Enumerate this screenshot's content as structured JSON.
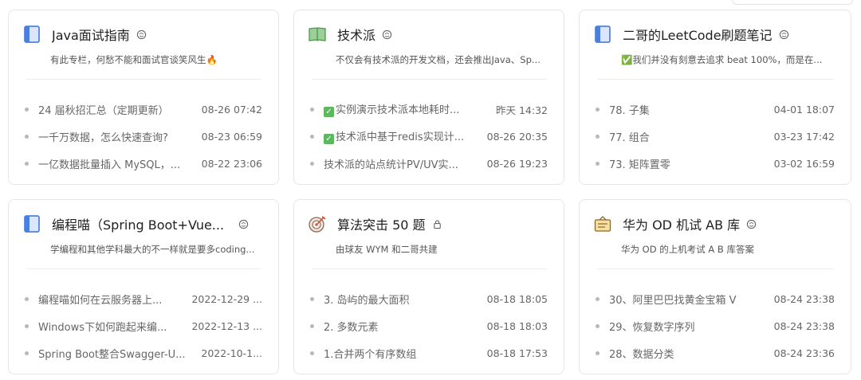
{
  "columns": [
    {
      "title": "Java面试指南",
      "icon": "blue-book-icon",
      "description": "有此专栏，何愁不能和面试官谈笑风生🔥",
      "articles": [
        {
          "title": "24 届秋招汇总（定期更新）",
          "time": "08-26 07:42"
        },
        {
          "title": "一千万数据，怎么快速查询?",
          "time": "08-23 06:59"
        },
        {
          "title": "一亿数据批量插入 MySQL，...",
          "time": "08-22 23:06"
        }
      ]
    },
    {
      "title": "技术派",
      "icon": "green-open-book-icon",
      "description": "不仅会有技术派的开发文档，还会推出Java、Sp...",
      "articles": [
        {
          "title": "实例演示技术派本地耗时...",
          "time": "昨天 14:32",
          "check": true
        },
        {
          "title": "技术派中基于redis实现计...",
          "time": "08-26 20:35",
          "check": true
        },
        {
          "title": "技术派的站点统计PV/UV实...",
          "time": "08-26 19:23"
        }
      ]
    },
    {
      "title": "二哥的LeetCode刷题笔记",
      "icon": "blue-book-icon",
      "description": "✅我们并没有刻意去追求 beat 100%，而是在...",
      "articles": [
        {
          "title": "78. 子集",
          "time": "04-01 18:07"
        },
        {
          "title": "77. 组合",
          "time": "03-23 17:42"
        },
        {
          "title": "73. 矩阵置零",
          "time": "03-02 16:59"
        }
      ]
    },
    {
      "title": "编程喵（Spring Boot+Vue...",
      "icon": "blue-book-icon",
      "description": "学编程和其他学科最大的不一样就是要多coding...",
      "articles": [
        {
          "title": "编程喵如何在云服务器上...",
          "time": "2022-12-29 ..."
        },
        {
          "title": "Windows下如何跑起来编...",
          "time": "2022-12-13 ..."
        },
        {
          "title": "Spring Boot整合Swagger-U...",
          "time": "2022-10-1..."
        }
      ]
    },
    {
      "title": "算法突击 50 题",
      "icon": "target-icon",
      "badge": "lock-icon",
      "description": "由球友 WYM 和二哥共建",
      "articles": [
        {
          "title": "3. 岛屿的最大面积",
          "time": "08-18 18:05"
        },
        {
          "title": "2. 多数元素",
          "time": "08-18 18:03"
        },
        {
          "title": "1.合并两个有序数组",
          "time": "08-18 17:53"
        }
      ]
    },
    {
      "title": "华为 OD 机试 AB 库",
      "icon": "notice-board-icon",
      "description": "华为 OD 的上机考试 A B 库答案",
      "articles": [
        {
          "title": "30、阿里巴巴找黄金宝箱 V",
          "time": "08-24 23:38"
        },
        {
          "title": "29、恢复数字序列",
          "time": "08-24 23:38"
        },
        {
          "title": "28、数据分类",
          "time": "08-24 23:36"
        }
      ]
    }
  ]
}
